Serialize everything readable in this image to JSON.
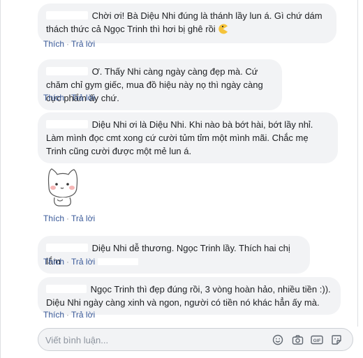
{
  "comments": [
    {
      "text": "Chời ơi! Bà Diệu Nhi đúng là thánh lầy lun á. Gì chứ dám thách thức cả Ngọc Trinh thì hơi bị ghê rồi",
      "emoji": "pacman-emoji",
      "like": "Thích",
      "reply": "Trả lời"
    },
    {
      "text": "Ơ. Thấy Nhi càng ngày càng đẹp mà. Cứ chăm chỉ gym giếc, mua đồ hiệu này nọ thì ngày càng cực phẩm ấy chứ.",
      "like": "Thích",
      "reply": "Trả lời"
    },
    {
      "text": "Diệu Nhi ơi là Diệu Nhi. Khi nào bà bớt hài, bớt lầy nhỉ. Làm mình đọc cmt xong cứ cười tủm tỉm một mình mãi. Chắc mẹ Trinh cũng cười được một mẻ lun á.",
      "sticker": "cat-sticker",
      "like": "Thích",
      "reply": "Trả lời"
    },
    {
      "text": "Diệu Nhi dễ thương. Ngọc Trinh lầy. Thích hai chị lắm",
      "like": "Thích",
      "reply": "Trả lời"
    },
    {
      "text": "Ngọc Trinh thì đẹp đúng rồi, 3 vòng hoàn hảo, nhiều tiền :)). Diệu Nhi ngày càng xinh và ngon, người có tiền nó khác hẳn ấy mà.",
      "like": "Thích",
      "reply": "Trả lời"
    }
  ],
  "composer": {
    "placeholder": "Viết bình luận...",
    "icons": [
      "emoji-icon",
      "camera-icon",
      "gif-icon",
      "sticker-icon"
    ]
  },
  "colors": {
    "bubble": "#f2f3f5",
    "link": "#385898",
    "meta": "#606770",
    "border": "#dddfe2"
  }
}
